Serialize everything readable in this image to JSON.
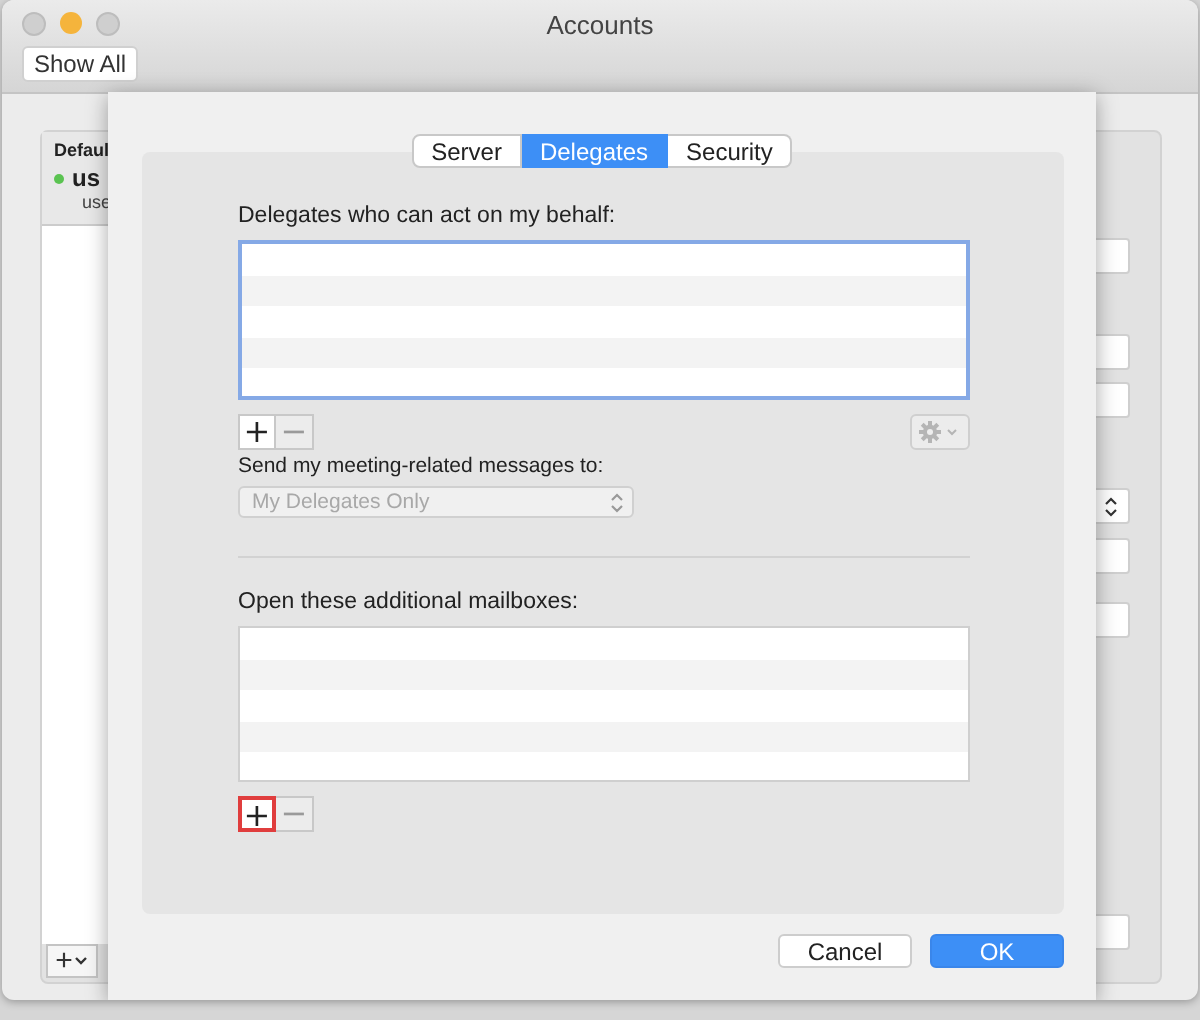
{
  "window": {
    "title": "Accounts",
    "show_all": "Show All"
  },
  "accounts": {
    "header": "Defaul",
    "items": [
      {
        "name": "us",
        "email": "use",
        "color": "#5ac351"
      }
    ],
    "add": "+"
  },
  "sheet": {
    "tabs": [
      {
        "label": "Server",
        "selected": false
      },
      {
        "label": "Delegates",
        "selected": true
      },
      {
        "label": "Security",
        "selected": false
      }
    ],
    "delegates": {
      "label": "Delegates who can act on my behalf:",
      "focused": true,
      "add": {
        "label": "+",
        "highlighted": false
      },
      "remove": {
        "label": "−",
        "disabled": true
      },
      "gear_disabled": true,
      "send_label": "Send my meeting-related messages to:",
      "send_popup": {
        "value": "My Delegates Only",
        "disabled": true
      }
    },
    "mailboxes": {
      "label": "Open these additional mailboxes:",
      "add": {
        "label": "+",
        "highlighted": true
      },
      "remove": {
        "label": "−",
        "disabled": true
      }
    },
    "buttons": [
      {
        "label": "Cancel",
        "kind": "secondary"
      },
      {
        "label": "OK",
        "kind": "default"
      }
    ]
  }
}
